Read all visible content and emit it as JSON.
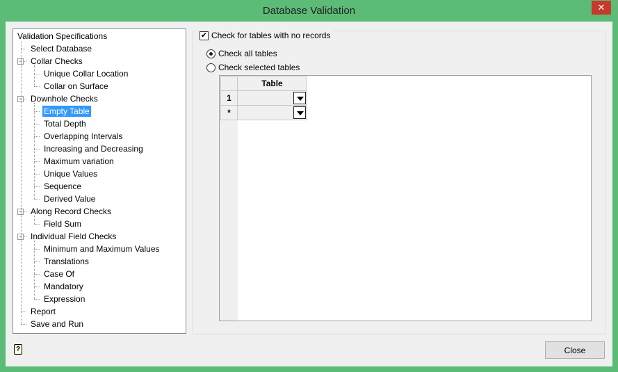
{
  "window": {
    "title": "Database Validation",
    "close_glyph": "✕"
  },
  "tree": {
    "items": [
      {
        "label": "Validation Specifications",
        "level": 0
      },
      {
        "label": "Select Database",
        "level": 1
      },
      {
        "label": "Collar Checks",
        "level": 1,
        "expander": true
      },
      {
        "label": "Unique Collar Location",
        "level": 2
      },
      {
        "label": "Collar on Surface",
        "level": 2
      },
      {
        "label": "Downhole Checks",
        "level": 1,
        "expander": true
      },
      {
        "label": "Empty Table",
        "level": 2,
        "selected": true
      },
      {
        "label": "Total Depth",
        "level": 2
      },
      {
        "label": "Overlapping Intervals",
        "level": 2
      },
      {
        "label": "Increasing and Decreasing",
        "level": 2
      },
      {
        "label": "Maximum variation",
        "level": 2
      },
      {
        "label": "Unique Values",
        "level": 2
      },
      {
        "label": "Sequence",
        "level": 2
      },
      {
        "label": "Derived Value",
        "level": 2
      },
      {
        "label": "Along Record Checks",
        "level": 1,
        "expander": true
      },
      {
        "label": "Field Sum",
        "level": 2
      },
      {
        "label": "Individual Field Checks",
        "level": 1,
        "expander": true
      },
      {
        "label": "Minimum and Maximum Values",
        "level": 2
      },
      {
        "label": "Translations",
        "level": 2
      },
      {
        "label": "Case Of",
        "level": 2
      },
      {
        "label": "Mandatory",
        "level": 2
      },
      {
        "label": "Expression",
        "level": 2
      },
      {
        "label": "Report",
        "level": 1
      },
      {
        "label": "Save and Run",
        "level": 1
      }
    ]
  },
  "panel": {
    "check_empty": {
      "label": "Check for tables with no records",
      "checked": true
    },
    "radio_all": {
      "label": "Check all tables",
      "selected": true
    },
    "radio_selected": {
      "label": "Check selected tables",
      "selected": false
    },
    "grid": {
      "header": "Table",
      "rows": [
        {
          "num": "1",
          "value": ""
        },
        {
          "num": "*",
          "value": ""
        }
      ]
    }
  },
  "footer": {
    "help_glyph": "?",
    "close_label": "Close"
  }
}
